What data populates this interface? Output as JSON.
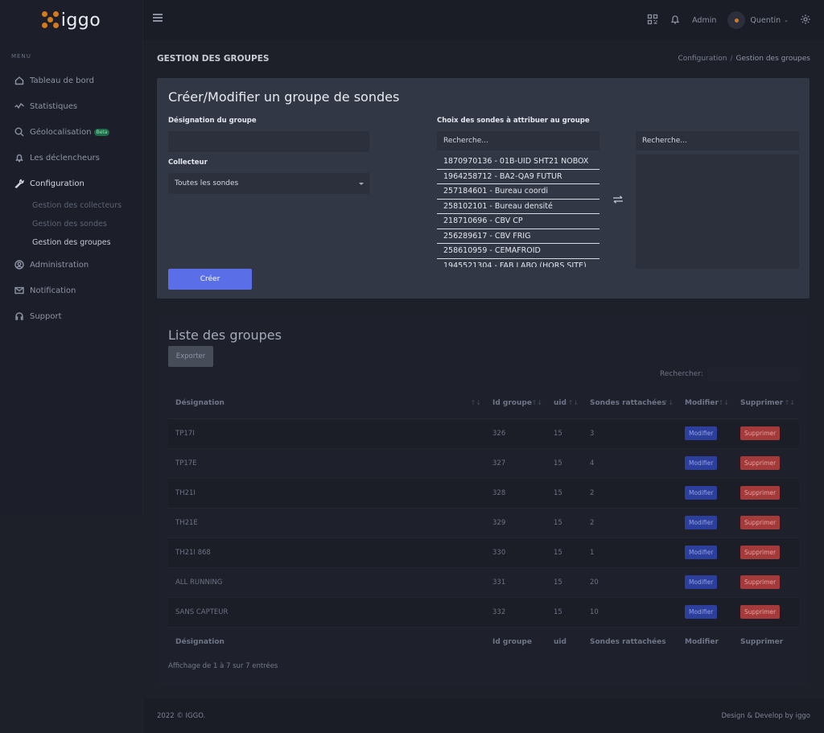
{
  "brand": {
    "logo_text": "iggo",
    "accent": "#d37a1e"
  },
  "sidebar": {
    "menu_title": "MENU",
    "items": [
      {
        "label": "Tableau de bord",
        "icon": "home-icon"
      },
      {
        "label": "Statistiques",
        "icon": "chart-icon"
      },
      {
        "label": "Géolocalisation",
        "icon": "search-location-icon",
        "badge": "Beta"
      },
      {
        "label": "Les déclencheurs",
        "icon": "bell-icon"
      },
      {
        "label": "Configuration",
        "icon": "wrench-icon"
      },
      {
        "label": "Administration",
        "icon": "user-circle-icon"
      },
      {
        "label": "Notification",
        "icon": "mail-icon"
      },
      {
        "label": "Support",
        "icon": "headset-icon"
      }
    ],
    "subitems": [
      {
        "label": "Gestion des collecteurs"
      },
      {
        "label": "Gestion des sondes"
      },
      {
        "label": "Gestion des groupes"
      }
    ]
  },
  "topbar": {
    "admin_label": "Admin",
    "user_name": "Quentin"
  },
  "page": {
    "title": "GESTION DES GROUPES",
    "breadcrumb": {
      "parent": "Configuration",
      "sep": "/",
      "current": "Gestion des groupes"
    }
  },
  "form": {
    "title": "Créer/Modifier un groupe de sondes",
    "designation_label": "Désignation du groupe",
    "designation_value": "",
    "collecteur_label": "Collecteur",
    "collecteur_value": "Toutes les sondes",
    "sondes_label": "Choix des sondes à attribuer au groupe",
    "search_left_placeholder": "Recherche...",
    "search_right_placeholder": "Recherche...",
    "sondes": [
      "1870970136 - 01B-UID SHT21 NOBOX",
      "1964258712 - BA2-QA9 FUTUR",
      "257184601 - Bureau coordi",
      "258102101 - Bureau densité",
      "218710696 - CBV CP",
      "256289617 - CBV FRIG",
      "258610959 - CEMAFROID",
      "1945521304 - FAB LABO (HORS SITE)"
    ],
    "create_button": "Créer"
  },
  "groups": {
    "title": "Liste des groupes",
    "export_button": "Exporter",
    "search_label": "Rechercher:",
    "columns": [
      "Désignation",
      "Id groupe",
      "uid",
      "Sondes rattachées",
      "Modifier",
      "Supprimer"
    ],
    "rows": [
      {
        "designation": "TP17I",
        "id": "326",
        "uid": "15",
        "sondes": "3"
      },
      {
        "designation": "TP17E",
        "id": "327",
        "uid": "15",
        "sondes": "4"
      },
      {
        "designation": "TH21I",
        "id": "328",
        "uid": "15",
        "sondes": "2"
      },
      {
        "designation": "TH21E",
        "id": "329",
        "uid": "15",
        "sondes": "2"
      },
      {
        "designation": "TH21I 868",
        "id": "330",
        "uid": "15",
        "sondes": "1"
      },
      {
        "designation": "ALL RUNNING",
        "id": "331",
        "uid": "15",
        "sondes": "20"
      },
      {
        "designation": "SANS CAPTEUR",
        "id": "332",
        "uid": "15",
        "sondes": "10"
      }
    ],
    "modify_button": "Modifier",
    "delete_button": "Supprimer",
    "info": "Affichage de 1 à 7 sur 7 entrées"
  },
  "footer": {
    "left": "2022 © IGGO.",
    "right": "Design & Develop by iggo"
  }
}
